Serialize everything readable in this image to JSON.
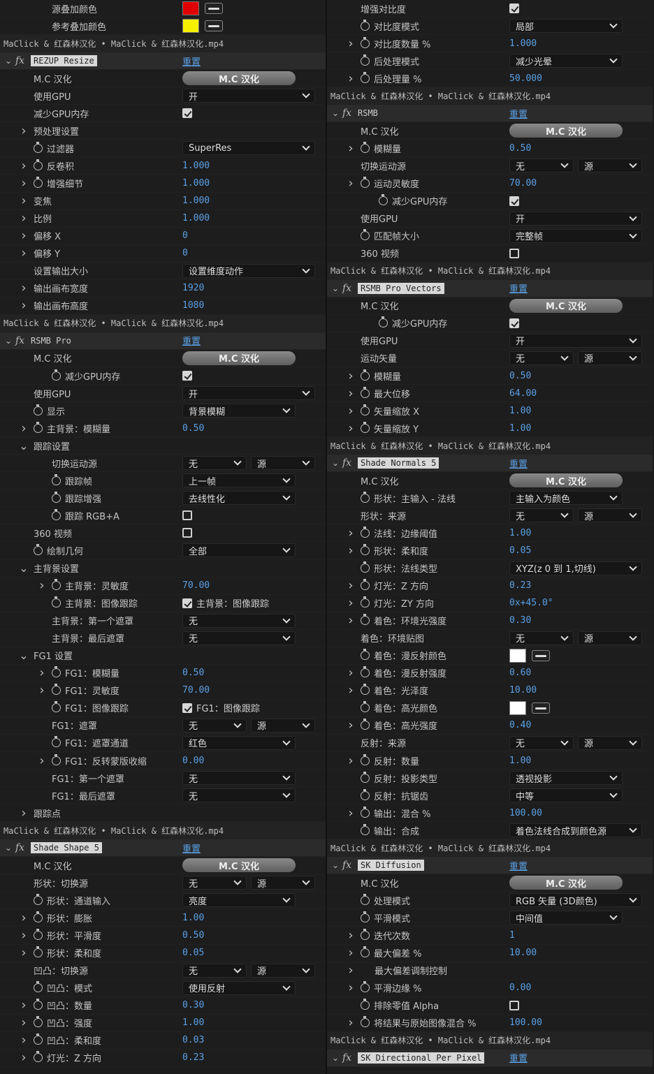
{
  "left": [
    {
      "t": "p",
      "lvl": 1,
      "nm": "源叠加颜色",
      "ctl": "color",
      "color": "#e00000"
    },
    {
      "t": "p",
      "lvl": 1,
      "nm": "参考叠加颜色",
      "ctl": "color",
      "color": "#f4f000"
    },
    {
      "t": "hdr",
      "text": "MaClick & 红森林汉化 • MaClick & 红森林汉化.mp4"
    },
    {
      "t": "fx",
      "name": "REZUP Resize",
      "reset": "重置"
    },
    {
      "t": "p",
      "lvl": 0,
      "nm": "M.C 汉化",
      "ctl": "mc",
      "val": "M.C 汉化"
    },
    {
      "t": "p",
      "lvl": 0,
      "nm": "使用GPU",
      "ctl": "dd",
      "val": "开",
      "w": 190
    },
    {
      "t": "p",
      "lvl": 0,
      "nm": "减少GPU内存",
      "ctl": "cb",
      "on": true
    },
    {
      "t": "p",
      "lvl": 0,
      "arrow": ">",
      "nm": "预处理设置"
    },
    {
      "t": "p",
      "lvl": 0,
      "sw": true,
      "nm": "过滤器",
      "ctl": "dd",
      "val": "SuperRes",
      "w": 190
    },
    {
      "t": "p",
      "lvl": 0,
      "arrow": ">",
      "sw": true,
      "nm": "反卷积",
      "ctl": "num",
      "val": "1.000"
    },
    {
      "t": "p",
      "lvl": 0,
      "arrow": ">",
      "sw": true,
      "nm": "增强细节",
      "ctl": "num",
      "val": "1.000"
    },
    {
      "t": "p",
      "lvl": 0,
      "arrow": ">",
      "nm": "变焦",
      "ctl": "num",
      "val": "1.000"
    },
    {
      "t": "p",
      "lvl": 0,
      "arrow": ">",
      "nm": "比例",
      "ctl": "num",
      "val": "1.000"
    },
    {
      "t": "p",
      "lvl": 0,
      "arrow": ">",
      "nm": "偏移 X",
      "ctl": "num",
      "val": "0"
    },
    {
      "t": "p",
      "lvl": 0,
      "arrow": ">",
      "nm": "偏移 Y",
      "ctl": "num",
      "val": "0"
    },
    {
      "t": "p",
      "lvl": 0,
      "nm": "设置输出大小",
      "ctl": "dd",
      "val": "设置维度动作",
      "w": 190
    },
    {
      "t": "p",
      "lvl": 0,
      "arrow": ">",
      "nm": "输出画布宽度",
      "ctl": "num",
      "val": "1920"
    },
    {
      "t": "p",
      "lvl": 0,
      "arrow": ">",
      "nm": "输出画布高度",
      "ctl": "num",
      "val": "1080"
    },
    {
      "t": "hdr",
      "text": "MaClick & 红森林汉化 • MaClick & 红森林汉化.mp4"
    },
    {
      "t": "fx",
      "name": "RSMB Pro",
      "plain": true,
      "reset": "重置"
    },
    {
      "t": "p",
      "lvl": 0,
      "nm": "M.C 汉化",
      "ctl": "mc",
      "val": "M.C 汉化"
    },
    {
      "t": "p",
      "lvl": 1,
      "sw": true,
      "nm": "减少GPU内存",
      "ctl": "cb",
      "on": true
    },
    {
      "t": "p",
      "lvl": 0,
      "nm": "使用GPU",
      "ctl": "dd",
      "val": "开",
      "w": 190
    },
    {
      "t": "p",
      "lvl": 0,
      "sw": true,
      "nm": "显示",
      "ctl": "dd",
      "val": "背景模糊",
      "w": 162
    },
    {
      "t": "p",
      "lvl": 0,
      "arrow": ">",
      "sw": true,
      "nm": "主背景：模糊量",
      "ctl": "num",
      "val": "0.50"
    },
    {
      "t": "p",
      "lvl": 0,
      "arrow": "v",
      "nm": "跟踪设置"
    },
    {
      "t": "p",
      "lvl": 1,
      "nm": "切换运动源",
      "ctl": "dd2",
      "val": "无",
      "val2": "源"
    },
    {
      "t": "p",
      "lvl": 1,
      "sw": true,
      "nm": "跟踪帧",
      "ctl": "dd",
      "val": "上一帧",
      "w": 162
    },
    {
      "t": "p",
      "lvl": 1,
      "sw": true,
      "nm": "跟踪增强",
      "ctl": "dd",
      "val": "去线性化",
      "w": 162
    },
    {
      "t": "p",
      "lvl": 1,
      "sw": true,
      "nm": "跟踪 RGB+A",
      "ctl": "cb",
      "on": false
    },
    {
      "t": "p",
      "lvl": 0,
      "nm": "360 视频",
      "ctl": "cb",
      "on": false
    },
    {
      "t": "p",
      "lvl": 0,
      "sw": true,
      "nm": "绘制几何",
      "ctl": "dd",
      "val": "全部",
      "w": 162
    },
    {
      "t": "p",
      "lvl": 0,
      "arrow": "v",
      "nm": "主背景设置"
    },
    {
      "t": "p",
      "lvl": 1,
      "arrow": ">",
      "sw": true,
      "nm": "主背景：灵敏度",
      "ctl": "num",
      "val": "70.00"
    },
    {
      "t": "p",
      "lvl": 1,
      "sw": true,
      "nm": "主背景：图像跟踪",
      "ctl": "cbl",
      "on": true,
      "val": "主背景：图像跟踪"
    },
    {
      "t": "p",
      "lvl": 1,
      "nm": "主背景：第一个遮罩",
      "ctl": "dd",
      "val": "无",
      "w": 162
    },
    {
      "t": "p",
      "lvl": 1,
      "nm": "主背景：最后遮罩",
      "ctl": "dd",
      "val": "无",
      "w": 162
    },
    {
      "t": "p",
      "lvl": 0,
      "arrow": "v",
      "nm": "FG1 设置"
    },
    {
      "t": "p",
      "lvl": 1,
      "arrow": ">",
      "sw": true,
      "nm": "FG1：模糊量",
      "ctl": "num",
      "val": "0.50"
    },
    {
      "t": "p",
      "lvl": 1,
      "arrow": ">",
      "sw": true,
      "nm": "FG1：灵敏度",
      "ctl": "num",
      "val": "70.00"
    },
    {
      "t": "p",
      "lvl": 1,
      "sw": true,
      "nm": "FG1：图像跟踪",
      "ctl": "cbl",
      "on": true,
      "val": "FG1：图像跟踪"
    },
    {
      "t": "p",
      "lvl": 1,
      "nm": "FG1：遮罩",
      "ctl": "dd2",
      "val": "无",
      "val2": "源"
    },
    {
      "t": "p",
      "lvl": 1,
      "sw": true,
      "nm": "FG1：遮罩通道",
      "ctl": "dd",
      "val": "红色",
      "w": 162
    },
    {
      "t": "p",
      "lvl": 1,
      "arrow": ">",
      "sw": true,
      "nm": "FG1：反转蒙版收缩",
      "ctl": "num",
      "val": "0.00"
    },
    {
      "t": "p",
      "lvl": 1,
      "nm": "FG1：第一个遮罩",
      "ctl": "dd",
      "val": "无",
      "w": 162
    },
    {
      "t": "p",
      "lvl": 1,
      "nm": "FG1：最后遮罩",
      "ctl": "dd",
      "val": "无",
      "w": 162
    },
    {
      "t": "p",
      "lvl": 0,
      "arrow": ">",
      "nm": "跟踪点"
    },
    {
      "t": "hdr",
      "text": "MaClick & 红森林汉化 • MaClick & 红森林汉化.mp4"
    },
    {
      "t": "fx",
      "name": "Shade Shape 5",
      "reset": "重置"
    },
    {
      "t": "p",
      "lvl": 0,
      "nm": "M.C 汉化",
      "ctl": "mc",
      "val": "M.C 汉化"
    },
    {
      "t": "p",
      "lvl": 0,
      "nm": "形状：切换源",
      "ctl": "dd2",
      "val": "无",
      "val2": "源"
    },
    {
      "t": "p",
      "lvl": 0,
      "sw": true,
      "nm": "形状：通道输入",
      "ctl": "dd",
      "val": "亮度",
      "w": 162
    },
    {
      "t": "p",
      "lvl": 0,
      "arrow": ">",
      "sw": true,
      "nm": "形状：膨胀",
      "ctl": "num",
      "val": "1.00"
    },
    {
      "t": "p",
      "lvl": 0,
      "arrow": ">",
      "sw": true,
      "nm": "形状：平滑度",
      "ctl": "num",
      "val": "0.50"
    },
    {
      "t": "p",
      "lvl": 0,
      "arrow": ">",
      "sw": true,
      "nm": "形状：柔和度",
      "ctl": "num",
      "val": "0.05"
    },
    {
      "t": "p",
      "lvl": 0,
      "nm": "凹凸：切换源",
      "ctl": "dd2",
      "val": "无",
      "val2": "源"
    },
    {
      "t": "p",
      "lvl": 0,
      "sw": true,
      "nm": "凹凸：模式",
      "ctl": "dd",
      "val": "使用反射",
      "w": 162
    },
    {
      "t": "p",
      "lvl": 0,
      "arrow": ">",
      "sw": true,
      "nm": "凹凸：数量",
      "ctl": "num",
      "val": "0.30"
    },
    {
      "t": "p",
      "lvl": 0,
      "arrow": ">",
      "sw": true,
      "nm": "凹凸：强度",
      "ctl": "num",
      "val": "1.00"
    },
    {
      "t": "p",
      "lvl": 0,
      "arrow": ">",
      "sw": true,
      "nm": "凹凸：柔和度",
      "ctl": "num",
      "val": "0.03"
    },
    {
      "t": "p",
      "lvl": 0,
      "arrow": ">",
      "sw": true,
      "nm": "灯光：Z 方向",
      "ctl": "num",
      "val": "0.23"
    }
  ],
  "right": [
    {
      "t": "p",
      "lvl": 0,
      "nm": "增强对比度",
      "ctl": "cb",
      "on": true
    },
    {
      "t": "p",
      "lvl": 0,
      "sw": true,
      "nm": "对比度模式",
      "ctl": "dd",
      "val": "局部",
      "w": 162
    },
    {
      "t": "p",
      "lvl": 0,
      "arrow": ">",
      "sw": true,
      "nm": "对比度数量 %",
      "ctl": "num",
      "val": "1.000"
    },
    {
      "t": "p",
      "lvl": 0,
      "sw": true,
      "nm": "后处理模式",
      "ctl": "dd",
      "val": "减少光晕",
      "w": 162
    },
    {
      "t": "p",
      "lvl": 0,
      "arrow": ">",
      "sw": true,
      "nm": "后处理量 %",
      "ctl": "num",
      "val": "50.000"
    },
    {
      "t": "hdr",
      "text": "MaClick & 红森林汉化 • MaClick & 红森林汉化.mp4"
    },
    {
      "t": "fx",
      "name": "RSMB",
      "plain": true,
      "reset": "重置"
    },
    {
      "t": "p",
      "lvl": 0,
      "nm": "M.C 汉化",
      "ctl": "mc",
      "val": "M.C 汉化"
    },
    {
      "t": "p",
      "lvl": 0,
      "arrow": ">",
      "sw": true,
      "nm": "模糊量",
      "ctl": "num",
      "val": "0.50"
    },
    {
      "t": "p",
      "lvl": 0,
      "nm": "切换运动源",
      "ctl": "dd2",
      "val": "无",
      "val2": "源"
    },
    {
      "t": "p",
      "lvl": 0,
      "arrow": ">",
      "sw": true,
      "nm": "运动灵敏度",
      "ctl": "num",
      "val": "70.00"
    },
    {
      "t": "p",
      "lvl": 1,
      "sw": true,
      "nm": "减少GPU内存",
      "ctl": "cb",
      "on": true
    },
    {
      "t": "p",
      "lvl": 0,
      "nm": "使用GPU",
      "ctl": "dd",
      "val": "开",
      "w": 190
    },
    {
      "t": "p",
      "lvl": 0,
      "sw": true,
      "nm": "匹配帧大小",
      "ctl": "dd",
      "val": "完整帧",
      "w": 190
    },
    {
      "t": "p",
      "lvl": 0,
      "nm": "360 视频",
      "ctl": "cb",
      "on": false
    },
    {
      "t": "hdr",
      "text": "MaClick & 红森林汉化 • MaClick & 红森林汉化.mp4"
    },
    {
      "t": "fx",
      "name": "RSMB Pro Vectors",
      "reset": "重置"
    },
    {
      "t": "p",
      "lvl": 0,
      "nm": "M.C 汉化",
      "ctl": "mc",
      "val": "M.C 汉化"
    },
    {
      "t": "p",
      "lvl": 1,
      "sw": true,
      "nm": "减少GPU内存",
      "ctl": "cb",
      "on": true
    },
    {
      "t": "p",
      "lvl": 0,
      "nm": "使用GPU",
      "ctl": "dd",
      "val": "开",
      "w": 190
    },
    {
      "t": "p",
      "lvl": 0,
      "nm": "运动矢量",
      "ctl": "dd2",
      "val": "无",
      "val2": "源"
    },
    {
      "t": "p",
      "lvl": 0,
      "arrow": ">",
      "sw": true,
      "nm": "模糊量",
      "ctl": "num",
      "val": "0.50"
    },
    {
      "t": "p",
      "lvl": 0,
      "arrow": ">",
      "sw": true,
      "nm": "最大位移",
      "ctl": "num",
      "val": "64.00"
    },
    {
      "t": "p",
      "lvl": 0,
      "arrow": ">",
      "sw": true,
      "nm": "矢量缩放 X",
      "ctl": "num",
      "val": "1.00"
    },
    {
      "t": "p",
      "lvl": 0,
      "arrow": ">",
      "sw": true,
      "nm": "矢量缩放 Y",
      "ctl": "num",
      "val": "1.00"
    },
    {
      "t": "hdr",
      "text": "MaClick & 红森林汉化 • MaClick & 红森林汉化.mp4"
    },
    {
      "t": "fx",
      "name": "Shade Normals 5",
      "reset": "重置"
    },
    {
      "t": "p",
      "lvl": 0,
      "nm": "M.C 汉化",
      "ctl": "mc",
      "val": "M.C 汉化"
    },
    {
      "t": "p",
      "lvl": 0,
      "sw": true,
      "nm": "形状：主输入 - 法线",
      "ctl": "dd",
      "val": "主输入为颜色",
      "w": 162
    },
    {
      "t": "p",
      "lvl": 0,
      "nm": "形状：来源",
      "ctl": "dd2",
      "val": "无",
      "val2": "源"
    },
    {
      "t": "p",
      "lvl": 0,
      "arrow": ">",
      "sw": true,
      "nm": "法线：边缘阈值",
      "ctl": "num",
      "val": "1.00"
    },
    {
      "t": "p",
      "lvl": 0,
      "arrow": ">",
      "sw": true,
      "nm": "形状：柔和度",
      "ctl": "num",
      "val": "0.05"
    },
    {
      "t": "p",
      "lvl": 0,
      "sw": true,
      "nm": "形状：法线类型",
      "ctl": "dd",
      "val": "XYZ(z 0 到 1,切线)",
      "w": 190
    },
    {
      "t": "p",
      "lvl": 0,
      "arrow": ">",
      "sw": true,
      "nm": "灯光：Z 方向",
      "ctl": "num",
      "val": "0.23"
    },
    {
      "t": "p",
      "lvl": 0,
      "arrow": ">",
      "sw": true,
      "nm": "灯光：ZY 方向",
      "ctl": "num",
      "val": "0x+45.0°"
    },
    {
      "t": "p",
      "lvl": 0,
      "arrow": ">",
      "sw": true,
      "nm": "着色：环境光强度",
      "ctl": "num",
      "val": "0.30"
    },
    {
      "t": "p",
      "lvl": 0,
      "nm": "着色：环境贴图",
      "ctl": "dd2",
      "val": "无",
      "val2": "源"
    },
    {
      "t": "p",
      "lvl": 0,
      "sw": true,
      "nm": "着色：漫反射颜色",
      "ctl": "color",
      "color": "#ffffff"
    },
    {
      "t": "p",
      "lvl": 0,
      "arrow": ">",
      "sw": true,
      "nm": "着色：漫反射强度",
      "ctl": "num",
      "val": "0.60"
    },
    {
      "t": "p",
      "lvl": 0,
      "arrow": ">",
      "sw": true,
      "nm": "着色：光泽度",
      "ctl": "num",
      "val": "10.00"
    },
    {
      "t": "p",
      "lvl": 0,
      "sw": true,
      "nm": "着色：高光颜色",
      "ctl": "color",
      "color": "#ffffff"
    },
    {
      "t": "p",
      "lvl": 0,
      "arrow": ">",
      "sw": true,
      "nm": "着色：高光强度",
      "ctl": "num",
      "val": "0.40"
    },
    {
      "t": "p",
      "lvl": 0,
      "nm": "反射：来源",
      "ctl": "dd2",
      "val": "无",
      "val2": "源"
    },
    {
      "t": "p",
      "lvl": 0,
      "arrow": ">",
      "sw": true,
      "nm": "反射：数量",
      "ctl": "num",
      "val": "1.00"
    },
    {
      "t": "p",
      "lvl": 0,
      "sw": true,
      "nm": "反射：投影类型",
      "ctl": "dd",
      "val": "透视投影",
      "w": 162
    },
    {
      "t": "p",
      "lvl": 0,
      "sw": true,
      "nm": "反射：抗锯齿",
      "ctl": "dd",
      "val": "中等",
      "w": 162
    },
    {
      "t": "p",
      "lvl": 0,
      "arrow": ">",
      "sw": true,
      "nm": "输出：混合 %",
      "ctl": "num",
      "val": "100.00"
    },
    {
      "t": "p",
      "lvl": 0,
      "sw": true,
      "nm": "输出：合成",
      "ctl": "dd",
      "val": "着色法线合成到颜色源",
      "w": 190
    },
    {
      "t": "hdr",
      "text": "MaClick & 红森林汉化 • MaClick & 红森林汉化.mp4"
    },
    {
      "t": "fx",
      "name": "SK Diffusion",
      "reset": "重置"
    },
    {
      "t": "p",
      "lvl": 0,
      "nm": "M.C 汉化",
      "ctl": "mc",
      "val": "M.C 汉化"
    },
    {
      "t": "p",
      "lvl": 0,
      "sw": true,
      "nm": "处理模式",
      "ctl": "dd",
      "val": "RGB 矢量 (3D颜色)",
      "w": 190
    },
    {
      "t": "p",
      "lvl": 0,
      "sw": true,
      "nm": "平滑模式",
      "ctl": "dd",
      "val": "中间值",
      "w": 162
    },
    {
      "t": "p",
      "lvl": 0,
      "arrow": ">",
      "sw": true,
      "nm": "迭代次数",
      "ctl": "num",
      "val": "1"
    },
    {
      "t": "p",
      "lvl": 0,
      "arrow": ">",
      "sw": true,
      "nm": "最大偏差 %",
      "ctl": "num",
      "val": "10.00"
    },
    {
      "t": "p",
      "lvl": 0,
      "arrow": ">",
      "nm": "最大偏差调制控制",
      "ind": true
    },
    {
      "t": "p",
      "lvl": 0,
      "arrow": ">",
      "sw": true,
      "nm": "平滑边缘 %",
      "ctl": "num",
      "val": "0.00"
    },
    {
      "t": "p",
      "lvl": 0,
      "sw": true,
      "nm": "排除零值 Alpha",
      "ctl": "cb",
      "on": false
    },
    {
      "t": "p",
      "lvl": 0,
      "arrow": ">",
      "sw": true,
      "nm": "将结果与原始图像混合 %",
      "ctl": "num",
      "val": "100.00"
    },
    {
      "t": "hdr",
      "text": "MaClick & 红森林汉化 • MaClick & 红森林汉化.mp4"
    },
    {
      "t": "fx",
      "name": "SK Directional Per Pixel",
      "reset": "重置"
    }
  ]
}
